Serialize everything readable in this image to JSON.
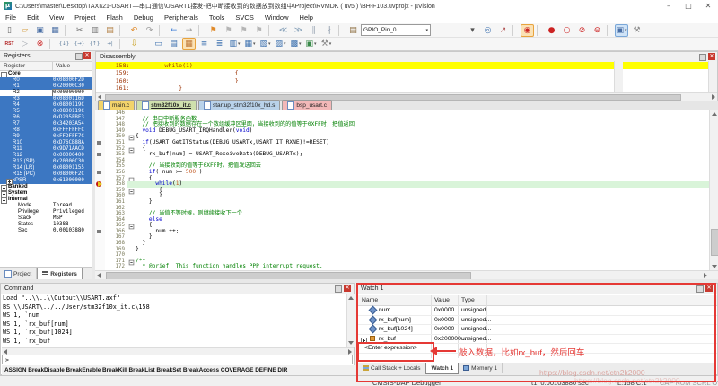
{
  "window": {
    "title": "C:\\Users\\master\\Desktop\\TAXI\\21-USART—串口通信\\USART1接发-把中断接收到的数据放到数组中\\Project\\RVMDK ( uv5 ) \\BH-F103.uvprojx - µVision",
    "minimize": "–",
    "maximize": "□",
    "close": "✕",
    "app_glyph": "µ"
  },
  "menu": {
    "items": [
      "File",
      "Edit",
      "View",
      "Project",
      "Flash",
      "Debug",
      "Peripherals",
      "Tools",
      "SVCS",
      "Window",
      "Help"
    ]
  },
  "toolbar": {
    "combo_value": "GPIO_Pin_0",
    "row1": [
      {
        "n": "new-file",
        "g": "▯",
        "c": "#666"
      },
      {
        "n": "open-folder",
        "g": "▱",
        "c": "#d49a3a"
      },
      {
        "n": "save",
        "g": "▣",
        "c": "#4a6fa5"
      },
      {
        "n": "save-all",
        "g": "▦",
        "c": "#4a6fa5"
      },
      {
        "sep": 1
      },
      {
        "n": "cut",
        "g": "✂",
        "c": "#666"
      },
      {
        "n": "copy",
        "g": "▥",
        "c": "#777"
      },
      {
        "n": "paste",
        "g": "▤",
        "c": "#b07c3f"
      },
      {
        "sep": 1
      },
      {
        "n": "undo",
        "g": "↶",
        "c": "#e08a2a"
      },
      {
        "n": "redo",
        "g": "↷",
        "c": "#9a9a9a"
      },
      {
        "sep": 1
      },
      {
        "n": "nav-back",
        "g": "←",
        "c": "#3a7bd5"
      },
      {
        "n": "nav-forward",
        "g": "→",
        "c": "#9a9a9a"
      },
      {
        "sep": 1
      },
      {
        "n": "bookmark-toggle",
        "g": "⚑",
        "c": "#e08a2a"
      },
      {
        "n": "bookmark-prev",
        "g": "⚑",
        "c": "#b5b5b5"
      },
      {
        "n": "bookmark-next",
        "g": "⚑",
        "c": "#b5b5b5"
      },
      {
        "n": "bookmark-clear",
        "g": "⚑",
        "c": "#b5b5b5"
      },
      {
        "sep": 1
      },
      {
        "n": "unindent",
        "g": "≪",
        "c": "#7f9bb5"
      },
      {
        "n": "indent",
        "g": "≫",
        "c": "#7f9bb5"
      },
      {
        "n": "comment-selection",
        "g": "∥",
        "c": "#9aa6b5"
      },
      {
        "n": "uncomment-selection",
        "g": "∦",
        "c": "#9aa6b5"
      },
      {
        "sep": 1
      },
      {
        "n": "flash-download",
        "g": "▤",
        "c": "#8a6a3a"
      },
      {
        "combo": 1
      },
      {
        "gap": 1
      },
      {
        "n": "search-dropdown",
        "g": "▾",
        "c": "#555"
      },
      {
        "n": "find-in-files",
        "g": "◎",
        "c": "#3a6fae"
      },
      {
        "n": "jump-to",
        "g": "↗",
        "c": "#b05050"
      },
      {
        "sep": 1
      },
      {
        "n": "start-stop-debug",
        "g": "◉",
        "c": "#cc2222",
        "sel": 1
      },
      {
        "sep": 1
      },
      {
        "n": "insert-breakpoint",
        "g": "●",
        "c": "#cc2222"
      },
      {
        "n": "toggle-breakpoint",
        "g": "○",
        "c": "#cc2222"
      },
      {
        "n": "kill-all-breakpoints",
        "g": "⊘",
        "c": "#cc2222"
      },
      {
        "n": "disable-all-breakpoints",
        "g": "⊖",
        "c": "#cc2222"
      },
      {
        "sep": 1
      },
      {
        "n": "window-layout",
        "g": "▣",
        "c": "#4a6fa5",
        "sel2": 1,
        "dd": 1
      },
      {
        "n": "configure-tools",
        "g": "⚒",
        "c": "#888"
      }
    ],
    "row2": [
      {
        "n": "reset-cpu",
        "g": "RST",
        "c": "#b22222",
        "rst": 1
      },
      {
        "n": "run",
        "g": "▷",
        "c": "#9aa0a8"
      },
      {
        "n": "stop",
        "g": "⊗",
        "c": "#cc2222"
      },
      {
        "sep": 1
      },
      {
        "n": "step-into",
        "g": "{↓}",
        "c": "#5a7a9a"
      },
      {
        "n": "step-over",
        "g": "{→}",
        "c": "#5a7a9a"
      },
      {
        "n": "step-out",
        "g": "{↑}",
        "c": "#5a7a9a"
      },
      {
        "n": "run-to-line",
        "g": "→|",
        "c": "#5a7a9a"
      },
      {
        "sep": 1
      },
      {
        "n": "show-current-statement",
        "g": "⇩",
        "c": "#c8a020"
      },
      {
        "sep": 1
      },
      {
        "n": "command-window",
        "g": "▭",
        "c": "#3a6fae"
      },
      {
        "n": "disassembly-window",
        "g": "▤",
        "c": "#3a6fae"
      },
      {
        "n": "symbol-window",
        "g": "▦",
        "c": "#c07a3a",
        "sel": 1
      },
      {
        "n": "registers-window",
        "g": "≡",
        "c": "#3a6fae"
      },
      {
        "n": "call-stack-window",
        "g": "≣",
        "c": "#3a6fae"
      },
      {
        "n": "watch-window",
        "g": "▥",
        "c": "#3a6fae",
        "dd": 1
      },
      {
        "n": "memory-window",
        "g": "▦",
        "c": "#3a6fae",
        "dd": 1
      },
      {
        "n": "serial-window",
        "g": "▧",
        "c": "#3a6fae",
        "dd": 1
      },
      {
        "n": "analysis-window",
        "g": "▨",
        "c": "#3a6fae",
        "dd": 1
      },
      {
        "n": "trace-window",
        "g": "▩",
        "c": "#3a6fae",
        "dd": 1
      },
      {
        "n": "system-viewer",
        "g": "▣",
        "c": "#3a8a4a",
        "dd": 1
      },
      {
        "n": "toolbox",
        "g": "⚒",
        "c": "#888",
        "dd": 1
      }
    ]
  },
  "registers": {
    "title": "Registers",
    "columns": [
      "Register",
      "Value"
    ],
    "rows": [
      {
        "t": "g",
        "l": "Core",
        "e": "m"
      },
      {
        "t": "r",
        "l": "R0",
        "v": "0x08000F2D",
        "hl": 1
      },
      {
        "t": "r",
        "l": "R1",
        "v": "0x20000C30",
        "hl": 1
      },
      {
        "t": "r",
        "l": "R2",
        "v": "0x00000000",
        "hl": 0
      },
      {
        "t": "r",
        "l": "R3",
        "v": "0x0800116D",
        "hl": 1
      },
      {
        "t": "r",
        "l": "R4",
        "v": "0x0800119C",
        "hl": 1
      },
      {
        "t": "r",
        "l": "R5",
        "v": "0x0800119C",
        "hl": 1
      },
      {
        "t": "r",
        "l": "R6",
        "v": "0xD205FBF3",
        "hl": 1
      },
      {
        "t": "r",
        "l": "R7",
        "v": "0x34203A54",
        "hl": 1
      },
      {
        "t": "r",
        "l": "R8",
        "v": "0xFFFFFFFC",
        "hl": 1
      },
      {
        "t": "r",
        "l": "R9",
        "v": "0xFFDFFF7C",
        "hl": 1
      },
      {
        "t": "r",
        "l": "R10",
        "v": "0xD76CB88A",
        "hl": 1
      },
      {
        "t": "r",
        "l": "R11",
        "v": "0x9D71AACD",
        "hl": 1
      },
      {
        "t": "r",
        "l": "R12",
        "v": "0x00000400",
        "hl": 1
      },
      {
        "t": "r",
        "l": "R13 (SP)",
        "v": "0x20000C30",
        "hl": 1
      },
      {
        "t": "r",
        "l": "R14 (LR)",
        "v": "0x08001155",
        "hl": 1
      },
      {
        "t": "r",
        "l": "R15 (PC)",
        "v": "0x08000F2C",
        "hl": 1
      },
      {
        "t": "r",
        "l": "xPSR",
        "v": "0x61000000",
        "hl": 1,
        "e": "p"
      },
      {
        "t": "g",
        "l": "Banked",
        "e": "p"
      },
      {
        "t": "g",
        "l": "System",
        "e": "p"
      },
      {
        "t": "g",
        "l": "Internal",
        "e": "m"
      },
      {
        "t": "f",
        "l": "Mode",
        "v": "Thread"
      },
      {
        "t": "f",
        "l": "Privilege",
        "v": "Privileged"
      },
      {
        "t": "f",
        "l": "Stack",
        "v": "MSP"
      },
      {
        "t": "f",
        "l": "States",
        "v": "10388"
      },
      {
        "t": "f",
        "l": "Sec",
        "v": "0.00103880"
      }
    ]
  },
  "left_tabs": {
    "items": [
      "Project",
      "Registers"
    ],
    "active": 1
  },
  "disassembly": {
    "title": "Disassembly",
    "lines": [
      {
        "text": "   158:          while(1)",
        "cur": 1
      },
      {
        "text": "   159:                              {",
        "cur": 0
      },
      {
        "text": "   160:                              }",
        "cur": 0
      },
      {
        "text": "   161:              }",
        "cur": 0
      }
    ]
  },
  "editor": {
    "tabs": [
      {
        "label": "main.c",
        "color": "#f2d36b"
      },
      {
        "label": "stm32f10x_it.c",
        "color": "#cfe0ad"
      },
      {
        "label": "startup_stm32f10x_hd.s",
        "color": "#b9d2ea"
      },
      {
        "label": "bsp_usart.c",
        "color": "#f3b8b8"
      }
    ],
    "active_tab": 1,
    "lines": [
      {
        "n": 146,
        "seg": []
      },
      {
        "n": 147,
        "seg": [
          [
            "  // 串口中断服务函数",
            "c"
          ]
        ]
      },
      {
        "n": 148,
        "seg": [
          [
            "  // 把接收到的数据存在一个数组缓冲区里面，当接收到的的值等于0XFF时，把值返回",
            "c"
          ]
        ]
      },
      {
        "n": 149,
        "seg": [
          [
            "  ",
            "p"
          ],
          [
            "void",
            "k"
          ],
          [
            " DEBUG_USART_IRQHandler(",
            "p"
          ],
          [
            "void",
            "k"
          ],
          [
            ")",
            "p"
          ]
        ]
      },
      {
        "n": 150,
        "f": "m",
        "seg": [
          [
            "{",
            "p"
          ]
        ]
      },
      {
        "n": 151,
        "g": "b",
        "seg": [
          [
            "  ",
            "p"
          ],
          [
            "if",
            "k"
          ],
          [
            "(USART_GetITStatus(DEBUG_USARTx,USART_IT_RXNE)!=RESET)",
            "p"
          ]
        ]
      },
      {
        "n": 152,
        "f": "m",
        "seg": [
          [
            "  {",
            "p"
          ]
        ]
      },
      {
        "n": 153,
        "g": "b",
        "seg": [
          [
            "    rx_buf[num] = USART_ReceiveData(DEBUG_USARTx);",
            "p"
          ]
        ]
      },
      {
        "n": 154,
        "seg": []
      },
      {
        "n": 155,
        "seg": [
          [
            "    ",
            "p"
          ],
          [
            "// 当接收到的值等于0XFF时，把值发送回去",
            "c"
          ]
        ]
      },
      {
        "n": 156,
        "g": "b",
        "seg": [
          [
            "    ",
            "p"
          ],
          [
            "if",
            "k"
          ],
          [
            "( num >= ",
            "p"
          ],
          [
            "500",
            "n"
          ],
          [
            " )",
            "p"
          ]
        ]
      },
      {
        "n": 157,
        "f": "m",
        "seg": [
          [
            "    {",
            "p"
          ]
        ]
      },
      {
        "n": 158,
        "g": "bp",
        "cur": 1,
        "seg": [
          [
            "      ",
            "p"
          ],
          [
            "while",
            "k"
          ],
          [
            "(",
            "p"
          ],
          [
            "1",
            "n"
          ],
          [
            ")",
            "p"
          ]
        ]
      },
      {
        "n": 159,
        "f": "m",
        "seg": [
          [
            "       {",
            "p"
          ]
        ]
      },
      {
        "n": 160,
        "seg": [
          [
            "       }",
            "p"
          ]
        ]
      },
      {
        "n": 161,
        "seg": [
          [
            "    }",
            "p"
          ]
        ]
      },
      {
        "n": 162,
        "seg": []
      },
      {
        "n": 163,
        "seg": [
          [
            "    ",
            "p"
          ],
          [
            "// 当值不等时候，则继续接收下一个",
            "c"
          ]
        ]
      },
      {
        "n": 164,
        "seg": [
          [
            "    ",
            "p"
          ],
          [
            "else",
            "k"
          ]
        ]
      },
      {
        "n": 165,
        "f": "m",
        "seg": [
          [
            "    {",
            "p"
          ]
        ]
      },
      {
        "n": 166,
        "g": "b",
        "seg": [
          [
            "      num ++;",
            "p"
          ]
        ]
      },
      {
        "n": 167,
        "seg": [
          [
            "    }",
            "p"
          ]
        ]
      },
      {
        "n": 168,
        "seg": [
          [
            "  }",
            "p"
          ]
        ]
      },
      {
        "n": 169,
        "seg": [
          [
            "}",
            "p"
          ]
        ]
      },
      {
        "n": 170,
        "seg": []
      },
      {
        "n": 171,
        "f": "m",
        "seg": [
          [
            "/**",
            "c"
          ]
        ]
      },
      {
        "n": 172,
        "seg": [
          [
            "  * @brief  This function handles PPP interrupt request.",
            "c"
          ]
        ]
      }
    ]
  },
  "command": {
    "title": "Command",
    "lines": [
      "Load \"..\\\\..\\\\Output\\\\USART.axf\"",
      "BS \\\\USART\\../../User/stm32f10x_it.c\\158",
      "WS 1, `num",
      "WS 1, `rx_buf[num]",
      "WS 1, `rx_buf[1024]",
      "WS 1, `rx_buf"
    ],
    "prompt": ">",
    "hints": "ASSIGN BreakDisable BreakEnable BreakKill BreakList BreakSet BreakAccess COVERAGE DEFINE DIR"
  },
  "watch": {
    "title": "Watch 1",
    "columns": [
      "Name",
      "Value",
      "Type"
    ],
    "rows": [
      {
        "icon": "var",
        "name": "num",
        "value": "0x0000",
        "type": "unsigned..."
      },
      {
        "icon": "var",
        "name": "rx_buf[num]",
        "value": "0x0000",
        "type": "unsigned..."
      },
      {
        "icon": "var",
        "name": "rx_buf[1024]",
        "value": "0x0000",
        "type": "unsigned..."
      },
      {
        "icon": "arr",
        "exp": "p",
        "name": "rx_buf",
        "value": "0x200000...",
        "type": "unsigned..."
      }
    ],
    "enter_row": "<Enter expression>",
    "tabs": [
      "Call Stack + Locals",
      "Watch 1",
      "Memory 1"
    ],
    "active_tab": 1
  },
  "annotation": {
    "text": "敲入数据，比如rx_buf，然后回车",
    "color": "#e53935"
  },
  "statusbar": {
    "debugger": "CMSIS-DAP Debugger",
    "time": "t1: 0.00103880 sec",
    "position": "L:158 C:1",
    "flags": "CAP NUM SCRL OVR R/W",
    "watermark": "https://blog.csdn.net/ctn2k2000"
  }
}
